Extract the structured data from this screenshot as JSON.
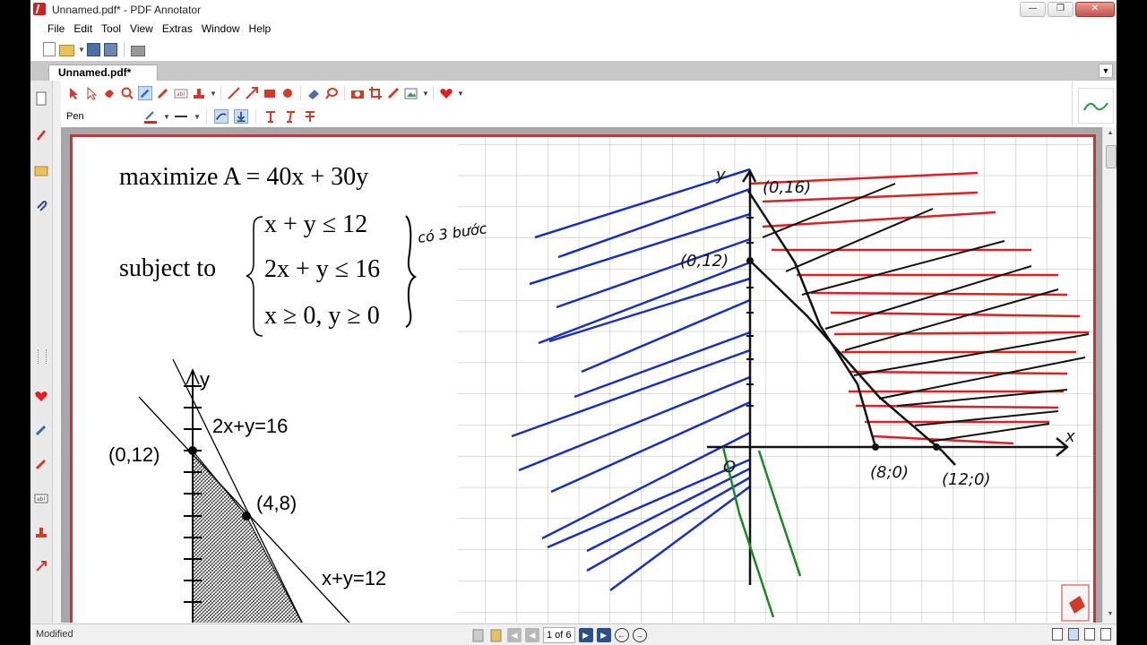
{
  "window": {
    "title": "Unnamed.pdf* - PDF Annotator",
    "controls": [
      "minimize",
      "maximize",
      "close"
    ]
  },
  "menu": [
    "File",
    "Edit",
    "Tool",
    "View",
    "Extras",
    "Window",
    "Help"
  ],
  "tab": {
    "label": "Unnamed.pdf*"
  },
  "tool": {
    "label": "Pen"
  },
  "document": {
    "objective": "maximize A = 40x + 30y",
    "subject_to": "subject to",
    "constraints": [
      "x + y ≤ 12",
      "2x + y ≤ 16",
      "x ≥ 0, y ≥ 0"
    ],
    "graph": {
      "axis_y": "y",
      "line1": "2x+y=16",
      "line2": "x+y=12",
      "point1": "(0,12)",
      "point2": "(4,8)"
    },
    "handwriting": {
      "bracket_note": "có 3 bước",
      "y_axis": "y",
      "x_axis": "x",
      "p_0_16": "(0,16)",
      "p_0_12": "(0,12)",
      "origin": "O",
      "p_8_0": "(8;0)",
      "p_12_0": "(12;0)"
    }
  },
  "status": {
    "text": "Modified",
    "page_indicator": "1 of 6"
  },
  "colors": {
    "pen_red": "#e02020",
    "pen_blue": "#1a2fc0",
    "pen_black": "#111111",
    "pen_green": "#1a8a20",
    "page_border": "#b04040"
  }
}
